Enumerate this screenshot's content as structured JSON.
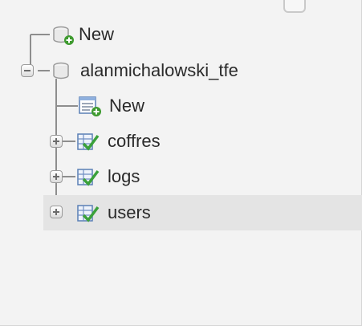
{
  "tree": {
    "root_new_label": "New",
    "database": {
      "name": "alanmichalowski_tfe",
      "new_table_label": "New",
      "tables": [
        {
          "name": "coffres"
        },
        {
          "name": "logs"
        },
        {
          "name": "users"
        }
      ]
    }
  },
  "icons": {
    "database": "database-icon",
    "new_database": "new-database-icon",
    "new_table": "new-table-icon",
    "table": "table-icon",
    "expand": "expand-plus-icon",
    "collapse": "collapse-minus-icon"
  },
  "colors": {
    "panel_bg": "#f3f3f3",
    "hover_row_bg": "#e4e4e4",
    "text": "#2a2a2a",
    "tree_line": "#8e8e8e"
  }
}
